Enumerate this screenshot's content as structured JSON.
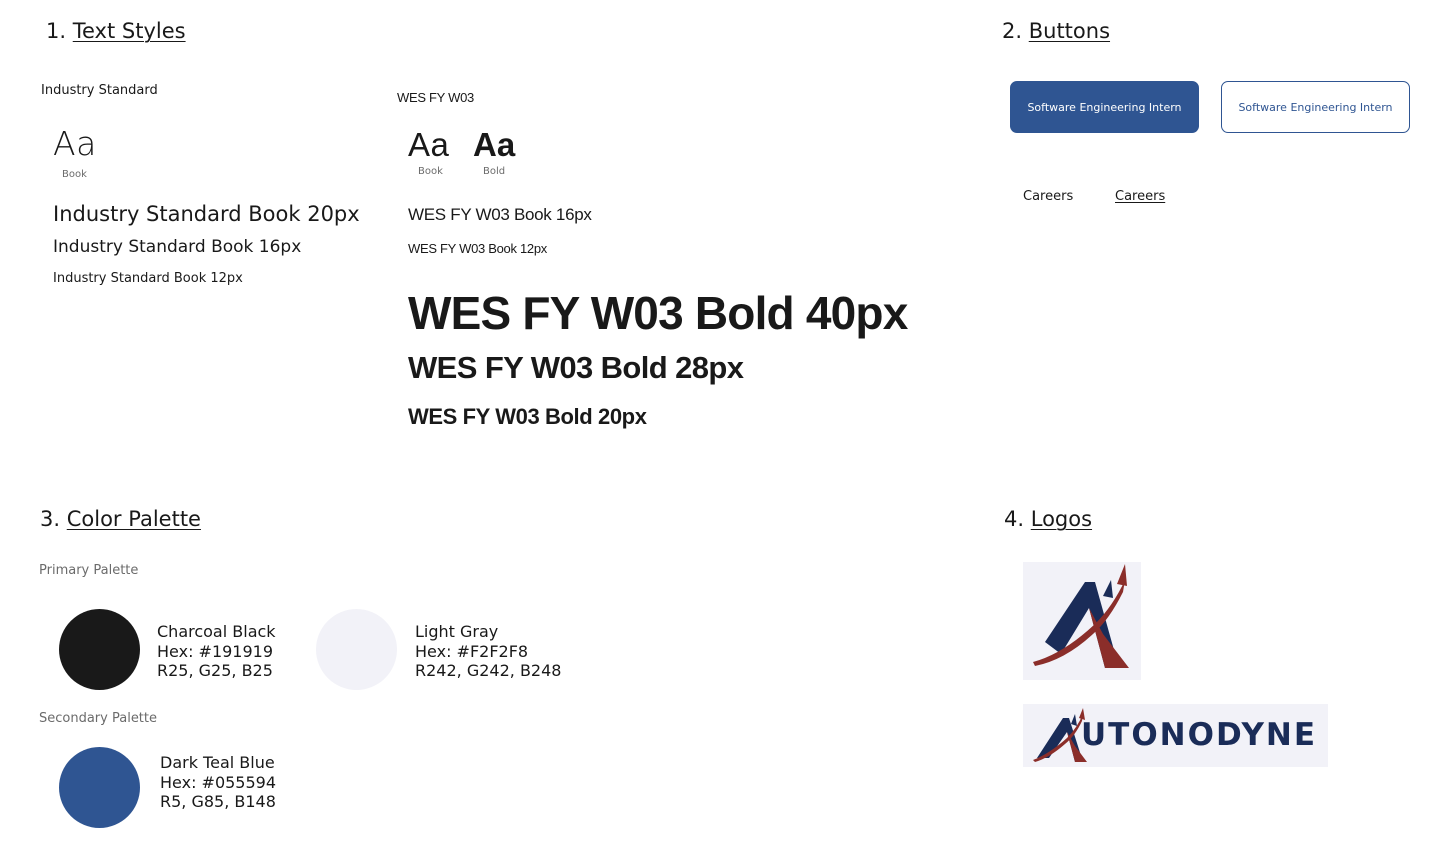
{
  "sections": {
    "text_styles": {
      "num": "1.",
      "title": "Text Styles"
    },
    "buttons": {
      "num": "2.",
      "title": "Buttons"
    },
    "color_palette": {
      "num": "3.",
      "title": "Color Palette"
    },
    "logos": {
      "num": "4.",
      "title": "Logos"
    }
  },
  "text_styles": {
    "industry": {
      "font_name": "Industry Standard",
      "sample": "Aa",
      "weight_label": "Book",
      "sizes": [
        "Industry Standard Book 20px",
        "Industry Standard Book 16px",
        "Industry Standard Book 12px"
      ]
    },
    "wes": {
      "font_name": "WES FY W03",
      "sample_book": "Aa",
      "sample_bold": "Aa",
      "book_label": "Book",
      "bold_label": "Bold",
      "book_sizes": [
        "WES FY W03 Book 16px",
        "WES FY W03 Book 12px"
      ],
      "bold_sizes": [
        "WES FY W03 Bold 40px",
        "WES FY W03 Bold 28px",
        "WES FY W03 Bold 20px"
      ]
    }
  },
  "buttons": {
    "primary_label": "Software Engineering Intern",
    "secondary_label": "Software Engineering Intern",
    "link_label": "Careers",
    "link_hover_label": "Careers"
  },
  "palette": {
    "primary_label": "Primary Palette",
    "secondary_label": "Secondary Palette",
    "colors": [
      {
        "name": "Charcoal Black",
        "hex": "Hex: #191919",
        "rgb": "R25, G25, B25",
        "swatch": "#191919"
      },
      {
        "name": "Light Gray",
        "hex": "Hex: #F2F2F8",
        "rgb": "R242, G242, B248",
        "swatch": "#F2F2F8"
      },
      {
        "name": "Dark Teal Blue",
        "hex": "Hex: #055594",
        "rgb": "R5, G85, B148",
        "swatch": "#2f5592"
      }
    ]
  },
  "logos": {
    "wordmark": "UTONODYNE",
    "brand_navy": "#1a2c58",
    "brand_red": "#8b2e2a",
    "background": "#f2f2f8"
  }
}
